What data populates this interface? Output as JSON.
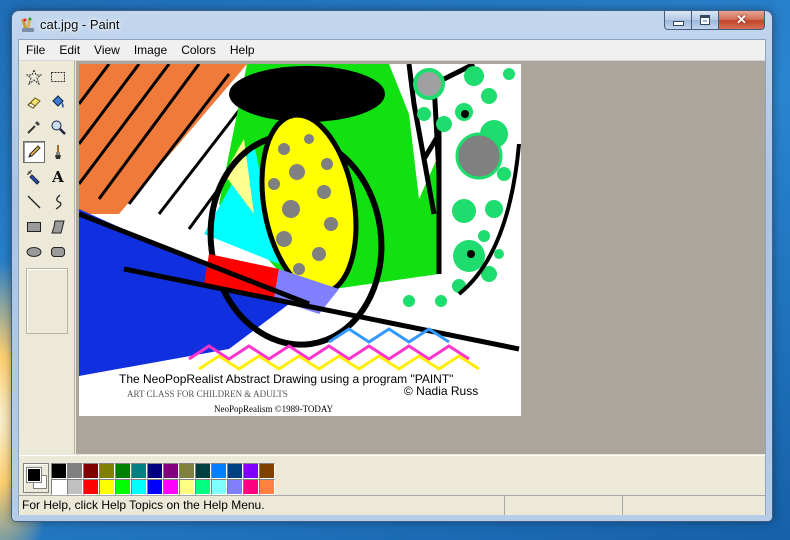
{
  "window": {
    "title": "cat.jpg - Paint",
    "caption_buttons": [
      "minimize-icon",
      "maximize-icon",
      "close-icon"
    ],
    "close_glyph": "✕"
  },
  "menu": {
    "items": [
      "File",
      "Edit",
      "View",
      "Image",
      "Colors",
      "Help"
    ]
  },
  "tools": [
    {
      "name": "free-form-select-icon"
    },
    {
      "name": "select-icon"
    },
    {
      "name": "eraser-icon"
    },
    {
      "name": "fill-bucket-icon"
    },
    {
      "name": "pick-color-icon"
    },
    {
      "name": "magnifier-icon"
    },
    {
      "name": "pencil-icon",
      "active": true
    },
    {
      "name": "brush-icon"
    },
    {
      "name": "airbrush-icon"
    },
    {
      "name": "text-icon",
      "glyph": "A"
    },
    {
      "name": "line-icon"
    },
    {
      "name": "curve-icon"
    },
    {
      "name": "rectangle-icon"
    },
    {
      "name": "polygon-icon"
    },
    {
      "name": "ellipse-icon"
    },
    {
      "name": "rounded-rectangle-icon"
    }
  ],
  "canvas": {
    "caption_line1": "The NeoPopRealist Abstract Drawing using a program \"PAINT\"",
    "caption_line2": "ART CLASS FOR CHILDREN & ADULTS",
    "caption_author": "© Nadia Russ",
    "caption_line3": "NeoPopRealism ©1989-TODAY"
  },
  "colors": {
    "foreground": "#000000",
    "background": "#ffffff",
    "palette": [
      "#000000",
      "#808080",
      "#800000",
      "#808000",
      "#008000",
      "#008080",
      "#000080",
      "#800080",
      "#808040",
      "#004040",
      "#0080ff",
      "#004080",
      "#8000ff",
      "#804000",
      "#ffffff",
      "#c0c0c0",
      "#ff0000",
      "#ffff00",
      "#00ff00",
      "#00ffff",
      "#0000ff",
      "#ff00ff",
      "#ffff80",
      "#00ff80",
      "#80ffff",
      "#8080ff",
      "#ff0080",
      "#ff8040"
    ]
  },
  "status": {
    "help_text": "For Help, click Help Topics on the Help Menu."
  }
}
